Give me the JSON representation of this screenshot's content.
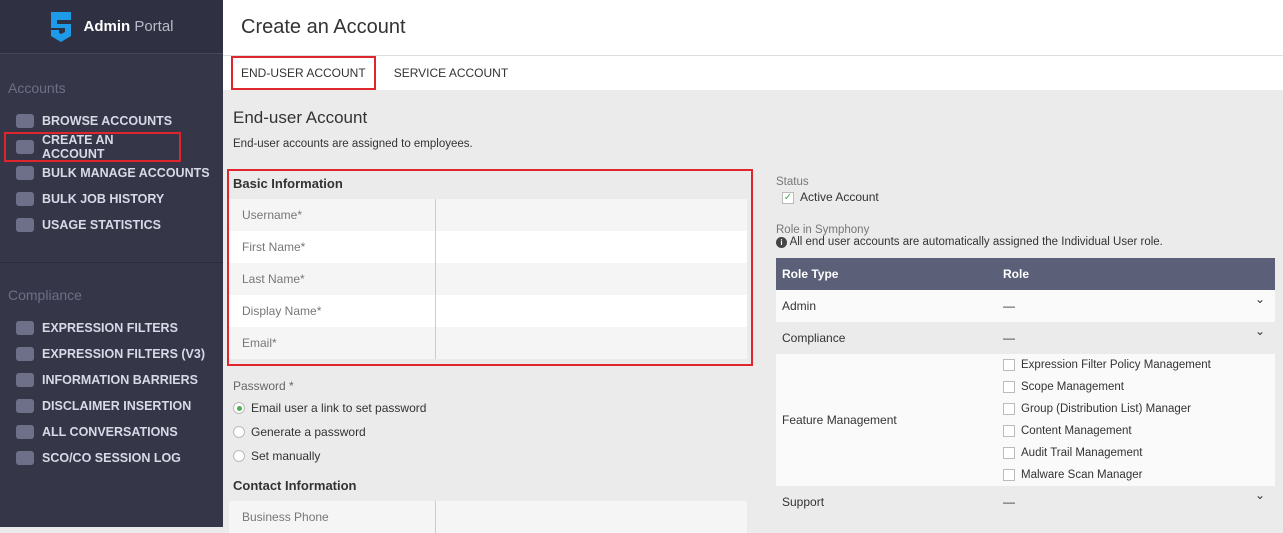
{
  "brand": {
    "bold": "Admin",
    "light": "Portal"
  },
  "sidebar": {
    "accounts_title": "Accounts",
    "accounts": [
      "BROWSE ACCOUNTS",
      "CREATE AN ACCOUNT",
      "BULK MANAGE ACCOUNTS",
      "BULK JOB HISTORY",
      "USAGE STATISTICS"
    ],
    "compliance_title": "Compliance",
    "compliance": [
      "EXPRESSION FILTERS",
      "EXPRESSION FILTERS (V3)",
      "INFORMATION BARRIERS",
      "DISCLAIMER INSERTION",
      "ALL CONVERSATIONS",
      "SCO/CO SESSION LOG"
    ]
  },
  "header": {
    "title": "Create an Account"
  },
  "tabs": [
    "END-USER ACCOUNT",
    "SERVICE ACCOUNT"
  ],
  "main": {
    "title": "End-user Account",
    "subtitle": "End-user accounts are assigned to employees.",
    "basic_title": "Basic Information",
    "fields": [
      "Username*",
      "First Name*",
      "Last Name*",
      "Display Name*",
      "Email*"
    ],
    "password_label": "Password *",
    "password_options": [
      "Email user a link to set password",
      "Generate a password",
      "Set manually"
    ],
    "contact_title": "Contact Information",
    "contact_fields": [
      "Business Phone"
    ]
  },
  "status": {
    "label": "Status",
    "active": "Active Account"
  },
  "role": {
    "label": "Role in Symphony",
    "info": "All end user accounts are automatically assigned the Individual User role.",
    "col1": "Role Type",
    "col2": "Role",
    "admin": "Admin",
    "compliance": "Compliance",
    "feature": "Feature Management",
    "support": "Support",
    "dash": "—",
    "features": [
      "Expression Filter Policy Management",
      "Scope Management",
      "Group (Distribution List) Manager",
      "Content Management",
      "Audit Trail Management",
      "Malware Scan Manager"
    ]
  }
}
